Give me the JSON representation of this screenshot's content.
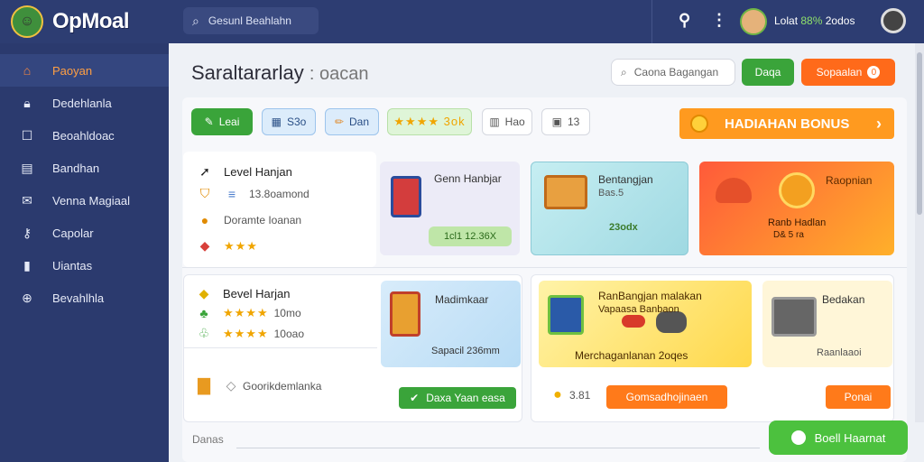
{
  "app": {
    "logo_text": "OpMoal",
    "search_placeholder": "Gesunl Beahlahn",
    "user_name_main": "Lolat",
    "user_name_hl": "88%",
    "user_name_tail": "2odos"
  },
  "sidebar": {
    "items": [
      {
        "label": "Paoyan",
        "icon": "home-icon"
      },
      {
        "label": "Dedehlanla",
        "icon": "lock-icon"
      },
      {
        "label": "Beoahldoac",
        "icon": "square-icon"
      },
      {
        "label": "Bandhan",
        "icon": "calendar-icon"
      },
      {
        "label": "Venna Magiaal",
        "icon": "chat-icon"
      },
      {
        "label": "Capolar",
        "icon": "key-icon"
      },
      {
        "label": "Uiantas",
        "icon": "doc-icon"
      },
      {
        "label": "Bevahlhla",
        "icon": "globe-icon"
      }
    ]
  },
  "main": {
    "title": "Saraltararlay",
    "title_sub": ": oacan",
    "search_placeholder": "Caona Bagangan",
    "btn_green": "Daqa",
    "btn_orange": "Sopaalan",
    "btn_orange_badge": "0"
  },
  "filters": [
    {
      "label": "Leai",
      "icon": "tag-icon"
    },
    {
      "label": "S3o",
      "icon": "cube-icon"
    },
    {
      "label": "Dan",
      "icon": "pencil-icon"
    },
    {
      "label": "★★★★ 3ok",
      "icon": "stars-icon"
    },
    {
      "label": "Hao",
      "icon": "chart-icon"
    },
    {
      "label": "13",
      "icon": "gift-icon"
    }
  ],
  "bonus": {
    "label": "HADIAHAN BONUS"
  },
  "left_card_top": {
    "title": "Level Hanjan",
    "row1": "13.8oamond",
    "row2": "Doramte Ioanan",
    "stars": "★★★"
  },
  "left_card_bottom": {
    "title": "Bevel Harjan",
    "row1": "10mo",
    "row2": "10oao",
    "stars": "★★★★",
    "item": "Goorikdemlanka"
  },
  "tiles": {
    "tile1": {
      "title": "Genn Hanbjar",
      "price": "1cl1 12.36X"
    },
    "tile2": {
      "title": "Bentangjan",
      "sub": "Bas.5",
      "price": "23odx"
    },
    "tile3": {
      "title": "Raopnian",
      "sub1": "Ranb Hadlan",
      "sub2": "D& 5 ra"
    },
    "tile4": {
      "title": "Madimkaar",
      "sub": "Sapacil 236mm"
    },
    "tile5": {
      "title": "RanBangjan malakan",
      "sub": "Vapaasa Banbaon",
      "footer": "Merchaganlanan 2oqes"
    },
    "tile6": {
      "title": "Bedakan",
      "sub": "Raanlaaoi"
    }
  },
  "buttons": {
    "green_cta": "Daxa Yaan easa",
    "coin_value": "3.81",
    "orange_cta": "Gomsadhojinaen",
    "orange_small": "Ponai"
  },
  "footer": {
    "label": "Danas"
  },
  "fab": {
    "label": "Boell Haarnat"
  },
  "colors": {
    "primary_nav": "#2b3a6e",
    "accent_orange": "#ff6a1a",
    "accent_green": "#3aa43a"
  }
}
